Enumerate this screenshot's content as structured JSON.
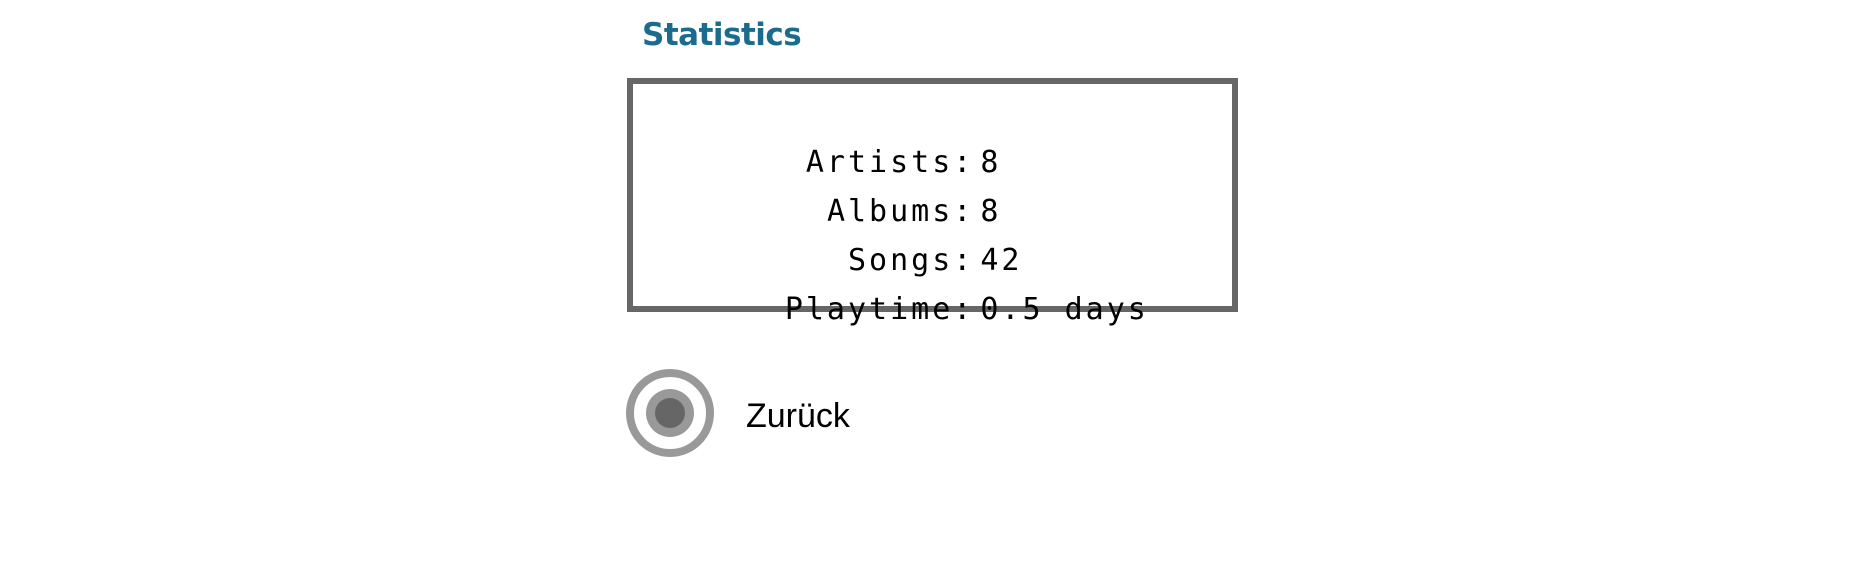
{
  "page": {
    "title": "Statistics"
  },
  "stats": [
    {
      "label": "Artists:",
      "value": "8"
    },
    {
      "label": "Albums:",
      "value": "8"
    },
    {
      "label": "Songs:",
      "value": "42"
    },
    {
      "label": "Playtime:",
      "value": "0.5 days"
    }
  ],
  "back": {
    "label": "Zurück",
    "icon": "radio-button-selected-icon",
    "selected": true
  },
  "colors": {
    "title": "#1b6b8c",
    "box_border": "#666666",
    "radio_ring": "#999999",
    "radio_dot": "#666666"
  }
}
